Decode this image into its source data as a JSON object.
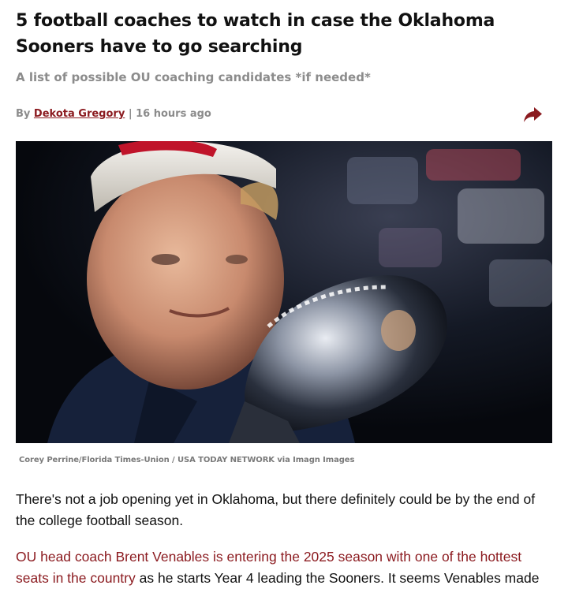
{
  "article": {
    "headline": "5 football coaches to watch in case the Oklahoma Sooners have to go searching",
    "subheadline": "A list of possible OU coaching candidates *if needed*",
    "byline": {
      "prefix": "By",
      "author": "Dekota Gregory",
      "separator": "|",
      "time": "16 hours ago"
    },
    "share_icon": "share-arrow-icon",
    "photo": {
      "icon": "photo-coach-with-trophy",
      "caption": "Corey Perrine/Florida Times-Union / USA TODAY NETWORK via Imagn Images"
    },
    "paragraph_1": "There's not a job opening yet in Oklahoma, but there definitely could be by the end of the college football season.",
    "paragraph_2": {
      "link_text": "OU head coach Brent Venables is entering the 2025 season with one of the hottest seats in the country",
      "rest": " as he starts Year 4 leading the Sooners. It seems Venables made"
    }
  },
  "colors": {
    "accent": "#8b1a1f",
    "meta_gray": "#8c8c8c",
    "text": "#111111"
  }
}
